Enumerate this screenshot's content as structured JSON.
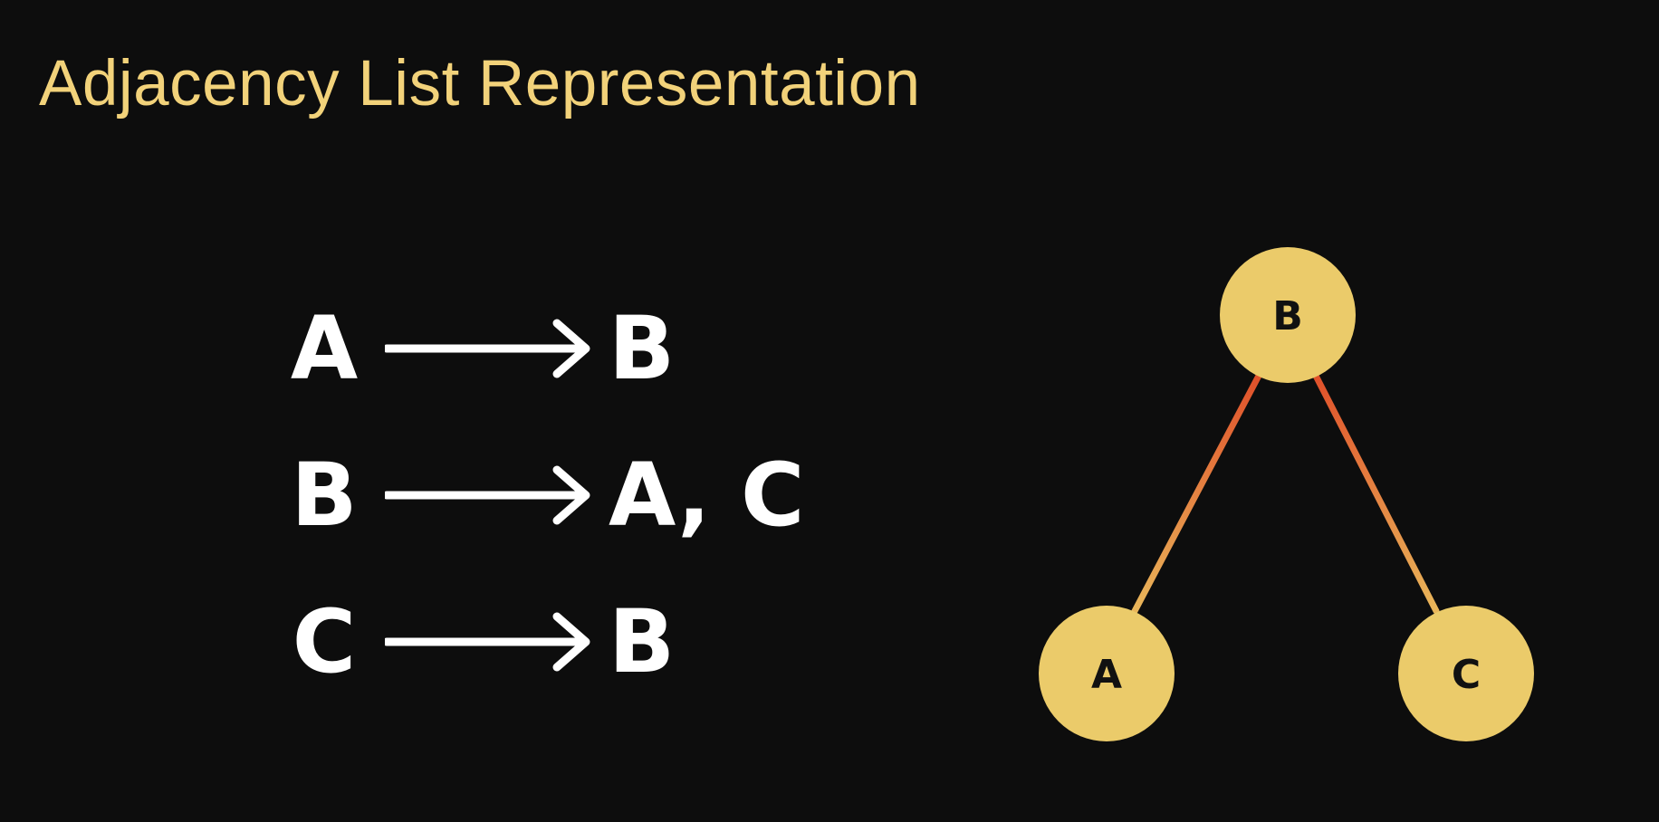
{
  "title": "Adjacency List Representation",
  "colors": {
    "title": "#f2d27a",
    "node_fill": "#ebcb6a",
    "node_text": "#111111",
    "edge_top": "#e0502a",
    "edge_bottom": "#e9b65a",
    "list_text": "#ffffff"
  },
  "adjacency_list": [
    {
      "node": "A",
      "neighbors": "B"
    },
    {
      "node": "B",
      "neighbors": "A, C"
    },
    {
      "node": "C",
      "neighbors": "B"
    }
  ],
  "graph": {
    "nodes": [
      {
        "id": "B",
        "label": "B"
      },
      {
        "id": "A",
        "label": "A"
      },
      {
        "id": "C",
        "label": "C"
      }
    ],
    "edges": [
      {
        "from": "B",
        "to": "A"
      },
      {
        "from": "B",
        "to": "C"
      }
    ]
  }
}
